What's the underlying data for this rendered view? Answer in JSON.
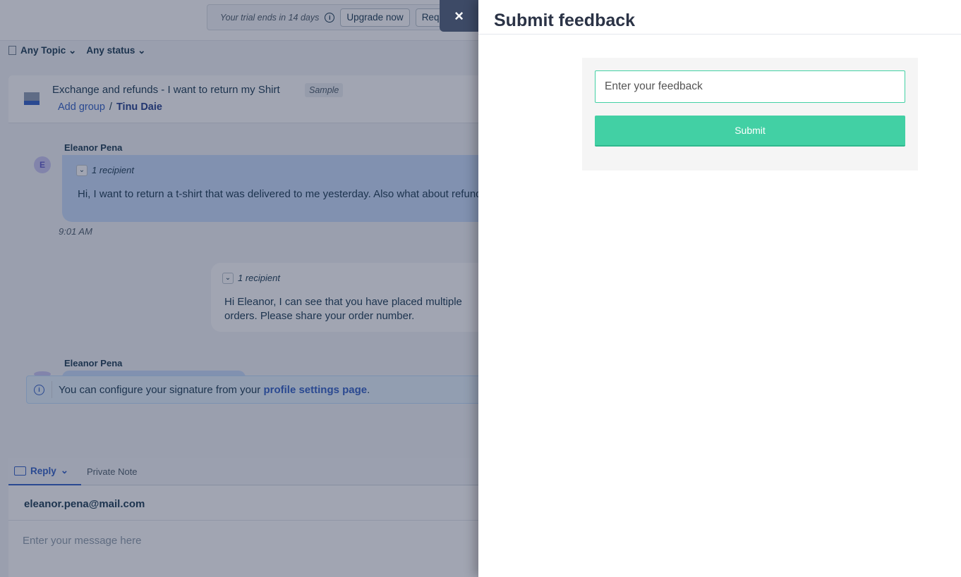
{
  "topbar": {
    "trial_text": "Your trial ends in 14 days",
    "upgrade_label": "Upgrade now",
    "request_label": "Request Demo"
  },
  "filters": {
    "topic": "Any Topic",
    "status": "Any status"
  },
  "ticket": {
    "title": "Exchange and refunds - I want to return my Shirt",
    "badge": "Sample",
    "group": "Add group",
    "agent": "Tinu Daie"
  },
  "conversation": [
    {
      "sender": "Eleanor Pena",
      "avatar": "E",
      "recipients": "1 recipient",
      "text": "Hi, I want to return a t-shirt that was delivered to me yesterday. Also what about refund?",
      "time": "9:01 AM"
    },
    {
      "recipients": "1 recipient",
      "text": "Hi Eleanor, I can see that you have placed multiple orders. Please share your order number."
    },
    {
      "sender": "Eleanor Pena"
    }
  ],
  "info": {
    "text": "You can configure your signature from your ",
    "link": "profile settings page",
    "end": "."
  },
  "editor": {
    "reply_tab": "Reply",
    "note_tab": "Private Note",
    "to": "eleanor.pena@mail.com",
    "placeholder": "Enter your message here"
  },
  "feedback": {
    "title": "Submit feedback",
    "placeholder": "Enter your feedback",
    "submit": "Submit",
    "close": "×"
  },
  "colors": {
    "accent": "#42d0a4",
    "link": "#2c5cc5"
  }
}
